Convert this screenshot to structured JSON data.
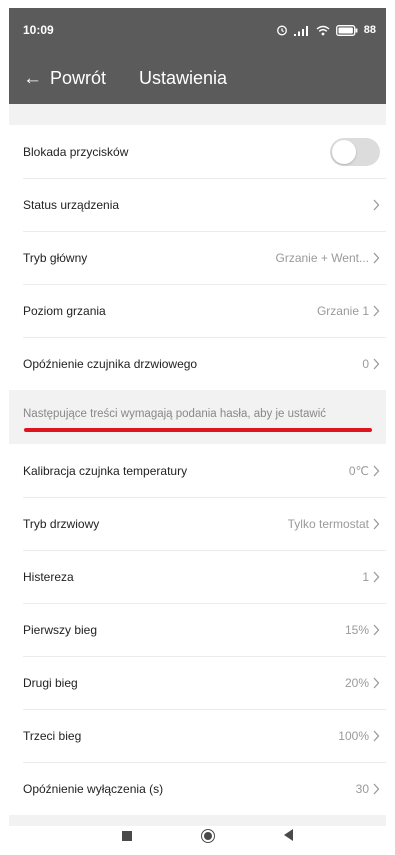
{
  "status_bar": {
    "time": "10:09",
    "battery": "88"
  },
  "app_bar": {
    "back_label": "Powrót",
    "back_arrow": "←",
    "title": "Ustawienia"
  },
  "settings_top": [
    {
      "label": "Blokada przycisków",
      "type": "toggle",
      "toggle_on": false
    },
    {
      "label": "Status urządzenia",
      "value": ""
    },
    {
      "label": "Tryb główny",
      "value": "Grzanie + Went..."
    },
    {
      "label": "Poziom grzania",
      "value": "Grzanie 1"
    },
    {
      "label": "Opóźnienie czujnika drzwiowego",
      "value": "0"
    }
  ],
  "section_note": "Następujące treści wymagają podania hasła, aby je ustawić",
  "settings_protected": [
    {
      "label": "Kalibracja czujnka temperatury",
      "value": "0℃"
    },
    {
      "label": "Tryb drzwiowy",
      "value": "Tylko termostat"
    },
    {
      "label": "Histereza",
      "value": "1"
    },
    {
      "label": "Pierwszy bieg",
      "value": "15%"
    },
    {
      "label": "Drugi bieg",
      "value": "20%"
    },
    {
      "label": "Trzeci bieg",
      "value": "100%"
    },
    {
      "label": "Opóźnienie wyłączenia (s)",
      "value": "30"
    }
  ],
  "colors": {
    "app_bar": "#5b5b5b",
    "highlight_underline": "#e0141e",
    "toggle_off": "#dcdcdc",
    "value_text": "#9a9a9a"
  },
  "icons": {
    "status": [
      "alarm-icon",
      "signal-icon",
      "wifi-icon",
      "battery-icon"
    ],
    "nav": [
      "recent-apps-icon",
      "home-icon",
      "back-icon"
    ]
  }
}
